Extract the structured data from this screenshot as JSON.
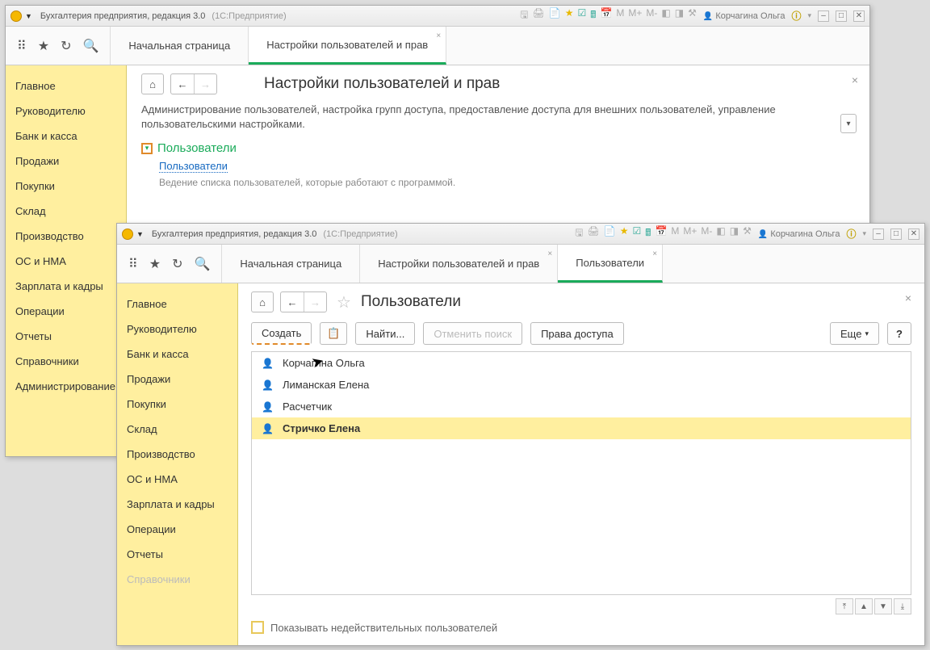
{
  "app": {
    "title": "Бухгалтерия предприятия, редакция 3.0",
    "engine": "(1С:Предприятие)",
    "user": "Корчагина Ольга"
  },
  "tabs1": {
    "start": "Начальная страница",
    "settings": "Настройки пользователей и прав"
  },
  "tabs2": {
    "start": "Начальная страница",
    "settings": "Настройки пользователей и прав",
    "users": "Пользователи"
  },
  "sidebar": {
    "items": [
      "Главное",
      "Руководителю",
      "Банк и касса",
      "Продажи",
      "Покупки",
      "Склад",
      "Производство",
      "ОС и НМА",
      "Зарплата и кадры",
      "Операции",
      "Отчеты",
      "Справочники",
      "Администрирование"
    ]
  },
  "page1": {
    "title": "Настройки пользователей и прав",
    "desc": "Администрирование пользователей, настройка групп доступа, предоставление доступа для внешних пользователей, управление пользовательскими настройками.",
    "section_title": "Пользователи",
    "section_link": "Пользователи",
    "section_desc": "Ведение списка пользователей, которые работают с программой."
  },
  "page2": {
    "title": "Пользователи",
    "btn_create": "Создать",
    "btn_find": "Найти...",
    "btn_cancel": "Отменить поиск",
    "btn_rights": "Права доступа",
    "btn_more": "Еще",
    "users": [
      "Корчагина Ольга",
      "Лиманская Елена",
      "Расчетчик",
      "Стричко Елена"
    ],
    "selected": 3,
    "footer_chk": "Показывать недействительных пользователей"
  }
}
